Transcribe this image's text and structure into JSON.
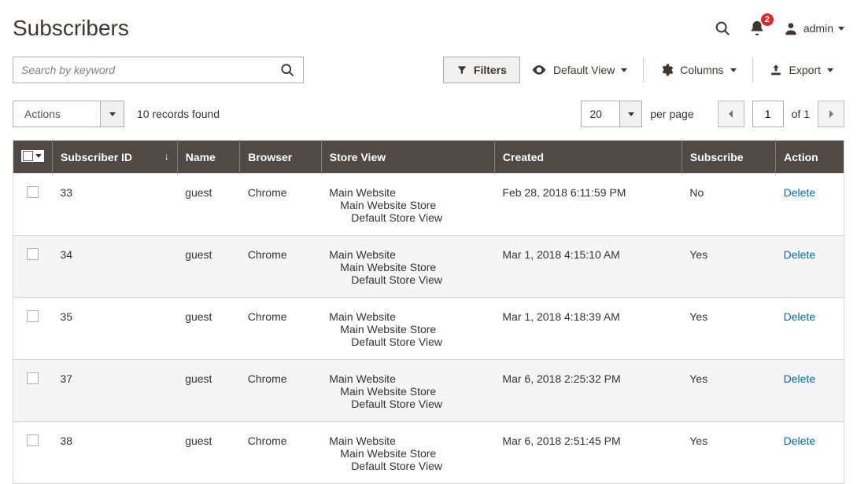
{
  "header": {
    "title": "Subscribers",
    "notifications_count": "2",
    "user_label": "admin"
  },
  "toolbar": {
    "search_placeholder": "Search by keyword",
    "filters_label": "Filters",
    "view_label": "Default View",
    "columns_label": "Columns",
    "export_label": "Export"
  },
  "listbar": {
    "actions_label": "Actions",
    "records_found": "10 records found",
    "perpage_value": "20",
    "perpage_label": "per page",
    "page_current": "1",
    "page_total_label": "of 1"
  },
  "columns": {
    "subscriber_id": "Subscriber ID",
    "name": "Name",
    "browser": "Browser",
    "store_view": "Store View",
    "created": "Created",
    "subscribe": "Subscribe",
    "action": "Action"
  },
  "store_tree": {
    "l1": "Main Website",
    "l2": "Main Website Store",
    "l3": "Default Store View"
  },
  "action_delete": "Delete",
  "rows": [
    {
      "id": "33",
      "name": "guest",
      "browser": "Chrome",
      "created": "Feb 28, 2018 6:11:59 PM",
      "subscribe": "No"
    },
    {
      "id": "34",
      "name": "guest",
      "browser": "Chrome",
      "created": "Mar 1, 2018 4:15:10 AM",
      "subscribe": "Yes"
    },
    {
      "id": "35",
      "name": "guest",
      "browser": "Chrome",
      "created": "Mar 1, 2018 4:18:39 AM",
      "subscribe": "Yes"
    },
    {
      "id": "37",
      "name": "guest",
      "browser": "Chrome",
      "created": "Mar 6, 2018 2:25:32 PM",
      "subscribe": "Yes"
    },
    {
      "id": "38",
      "name": "guest",
      "browser": "Chrome",
      "created": "Mar 6, 2018 2:51:45 PM",
      "subscribe": "Yes"
    }
  ]
}
